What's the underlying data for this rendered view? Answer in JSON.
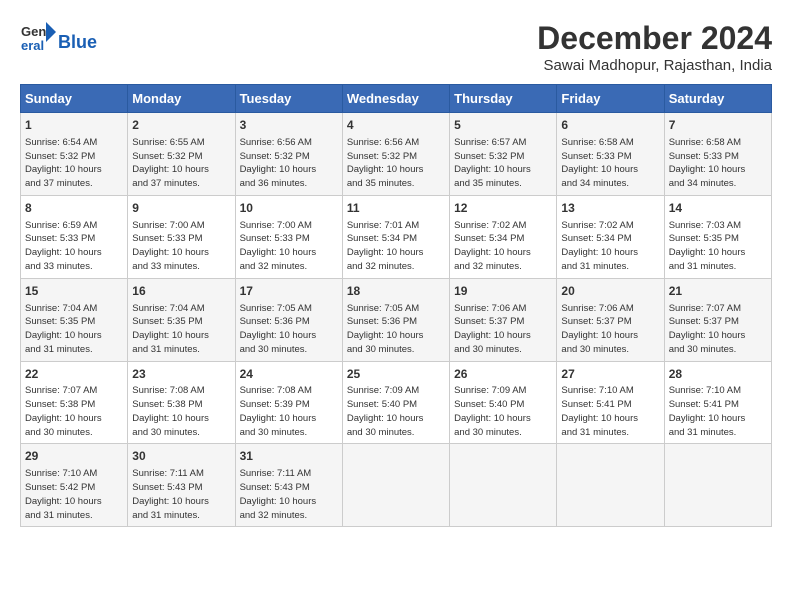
{
  "logo": {
    "line1": "General",
    "line2": "Blue"
  },
  "title": "December 2024",
  "location": "Sawai Madhopur, Rajasthan, India",
  "days_of_week": [
    "Sunday",
    "Monday",
    "Tuesday",
    "Wednesday",
    "Thursday",
    "Friday",
    "Saturday"
  ],
  "weeks": [
    [
      {
        "day": "1",
        "info": "Sunrise: 6:54 AM\nSunset: 5:32 PM\nDaylight: 10 hours\nand 37 minutes."
      },
      {
        "day": "2",
        "info": "Sunrise: 6:55 AM\nSunset: 5:32 PM\nDaylight: 10 hours\nand 37 minutes."
      },
      {
        "day": "3",
        "info": "Sunrise: 6:56 AM\nSunset: 5:32 PM\nDaylight: 10 hours\nand 36 minutes."
      },
      {
        "day": "4",
        "info": "Sunrise: 6:56 AM\nSunset: 5:32 PM\nDaylight: 10 hours\nand 35 minutes."
      },
      {
        "day": "5",
        "info": "Sunrise: 6:57 AM\nSunset: 5:32 PM\nDaylight: 10 hours\nand 35 minutes."
      },
      {
        "day": "6",
        "info": "Sunrise: 6:58 AM\nSunset: 5:33 PM\nDaylight: 10 hours\nand 34 minutes."
      },
      {
        "day": "7",
        "info": "Sunrise: 6:58 AM\nSunset: 5:33 PM\nDaylight: 10 hours\nand 34 minutes."
      }
    ],
    [
      {
        "day": "8",
        "info": "Sunrise: 6:59 AM\nSunset: 5:33 PM\nDaylight: 10 hours\nand 33 minutes."
      },
      {
        "day": "9",
        "info": "Sunrise: 7:00 AM\nSunset: 5:33 PM\nDaylight: 10 hours\nand 33 minutes."
      },
      {
        "day": "10",
        "info": "Sunrise: 7:00 AM\nSunset: 5:33 PM\nDaylight: 10 hours\nand 32 minutes."
      },
      {
        "day": "11",
        "info": "Sunrise: 7:01 AM\nSunset: 5:34 PM\nDaylight: 10 hours\nand 32 minutes."
      },
      {
        "day": "12",
        "info": "Sunrise: 7:02 AM\nSunset: 5:34 PM\nDaylight: 10 hours\nand 32 minutes."
      },
      {
        "day": "13",
        "info": "Sunrise: 7:02 AM\nSunset: 5:34 PM\nDaylight: 10 hours\nand 31 minutes."
      },
      {
        "day": "14",
        "info": "Sunrise: 7:03 AM\nSunset: 5:35 PM\nDaylight: 10 hours\nand 31 minutes."
      }
    ],
    [
      {
        "day": "15",
        "info": "Sunrise: 7:04 AM\nSunset: 5:35 PM\nDaylight: 10 hours\nand 31 minutes."
      },
      {
        "day": "16",
        "info": "Sunrise: 7:04 AM\nSunset: 5:35 PM\nDaylight: 10 hours\nand 31 minutes."
      },
      {
        "day": "17",
        "info": "Sunrise: 7:05 AM\nSunset: 5:36 PM\nDaylight: 10 hours\nand 30 minutes."
      },
      {
        "day": "18",
        "info": "Sunrise: 7:05 AM\nSunset: 5:36 PM\nDaylight: 10 hours\nand 30 minutes."
      },
      {
        "day": "19",
        "info": "Sunrise: 7:06 AM\nSunset: 5:37 PM\nDaylight: 10 hours\nand 30 minutes."
      },
      {
        "day": "20",
        "info": "Sunrise: 7:06 AM\nSunset: 5:37 PM\nDaylight: 10 hours\nand 30 minutes."
      },
      {
        "day": "21",
        "info": "Sunrise: 7:07 AM\nSunset: 5:37 PM\nDaylight: 10 hours\nand 30 minutes."
      }
    ],
    [
      {
        "day": "22",
        "info": "Sunrise: 7:07 AM\nSunset: 5:38 PM\nDaylight: 10 hours\nand 30 minutes."
      },
      {
        "day": "23",
        "info": "Sunrise: 7:08 AM\nSunset: 5:38 PM\nDaylight: 10 hours\nand 30 minutes."
      },
      {
        "day": "24",
        "info": "Sunrise: 7:08 AM\nSunset: 5:39 PM\nDaylight: 10 hours\nand 30 minutes."
      },
      {
        "day": "25",
        "info": "Sunrise: 7:09 AM\nSunset: 5:40 PM\nDaylight: 10 hours\nand 30 minutes."
      },
      {
        "day": "26",
        "info": "Sunrise: 7:09 AM\nSunset: 5:40 PM\nDaylight: 10 hours\nand 30 minutes."
      },
      {
        "day": "27",
        "info": "Sunrise: 7:10 AM\nSunset: 5:41 PM\nDaylight: 10 hours\nand 31 minutes."
      },
      {
        "day": "28",
        "info": "Sunrise: 7:10 AM\nSunset: 5:41 PM\nDaylight: 10 hours\nand 31 minutes."
      }
    ],
    [
      {
        "day": "29",
        "info": "Sunrise: 7:10 AM\nSunset: 5:42 PM\nDaylight: 10 hours\nand 31 minutes."
      },
      {
        "day": "30",
        "info": "Sunrise: 7:11 AM\nSunset: 5:43 PM\nDaylight: 10 hours\nand 31 minutes."
      },
      {
        "day": "31",
        "info": "Sunrise: 7:11 AM\nSunset: 5:43 PM\nDaylight: 10 hours\nand 32 minutes."
      },
      {
        "day": "",
        "info": ""
      },
      {
        "day": "",
        "info": ""
      },
      {
        "day": "",
        "info": ""
      },
      {
        "day": "",
        "info": ""
      }
    ]
  ]
}
